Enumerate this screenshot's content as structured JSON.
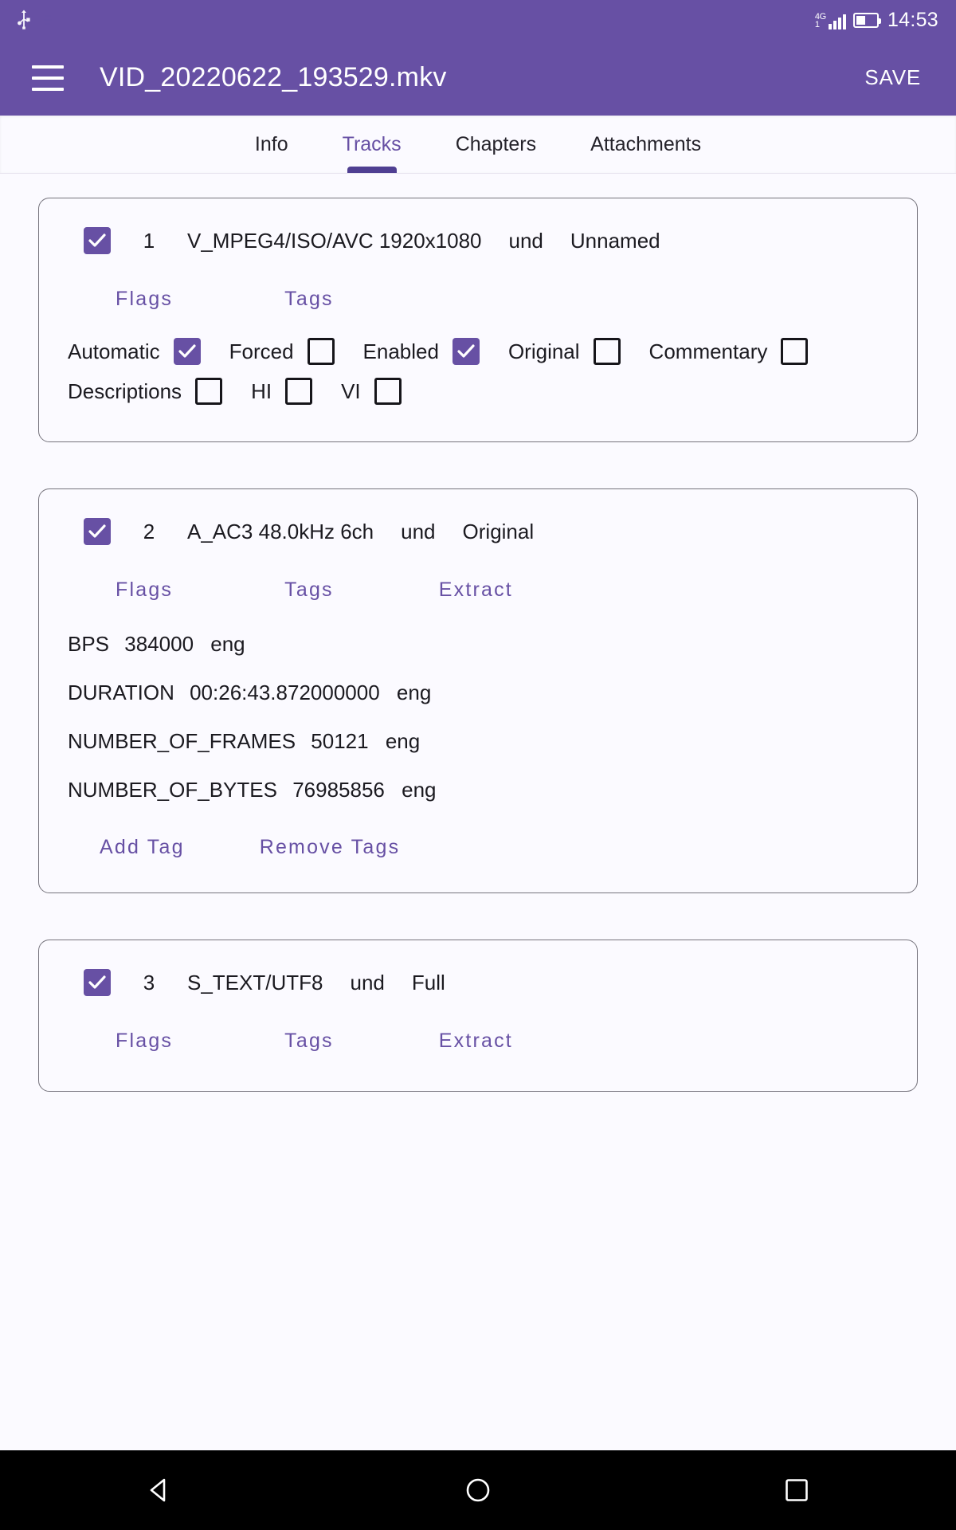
{
  "status_bar": {
    "usb_icon": "usb-icon",
    "dnd_icon": "moon-do-not-disturb-icon",
    "network_type": "4G",
    "network_sub": "1",
    "battery_icon": "battery-half-icon",
    "time": "14:53"
  },
  "app_bar": {
    "menu_icon": "hamburger-menu-icon",
    "title": "VID_20220622_193529.mkv",
    "save_label": "SAVE"
  },
  "tabs": [
    {
      "label": "Info",
      "active": false
    },
    {
      "label": "Tracks",
      "active": true
    },
    {
      "label": "Chapters",
      "active": false
    },
    {
      "label": "Attachments",
      "active": false
    }
  ],
  "colors": {
    "primary": "#6750a4",
    "primary_dark": "#4f3f92",
    "surface": "#fbfaff",
    "on_surface": "#1b1a20",
    "card_border": "#75737c",
    "nav_bar": "#000000"
  },
  "tracks": [
    {
      "checked": true,
      "number": "1",
      "codec": "V_MPEG4/ISO/AVC 1920x1080",
      "language": "und",
      "name": "Unnamed",
      "actions": [
        "Flags",
        "Tags"
      ],
      "flags": [
        {
          "label": "Automatic",
          "checked": true
        },
        {
          "label": "Forced",
          "checked": false
        },
        {
          "label": "Enabled",
          "checked": true
        },
        {
          "label": "Original",
          "checked": false
        },
        {
          "label": "Commentary",
          "checked": false
        },
        {
          "label": "Descriptions",
          "checked": false
        },
        {
          "label": "HI",
          "checked": false
        },
        {
          "label": "VI",
          "checked": false
        }
      ]
    },
    {
      "checked": true,
      "number": "2",
      "codec": "A_AC3 48.0kHz 6ch",
      "language": "und",
      "name": "Original",
      "actions": [
        "Flags",
        "Tags",
        "Extract"
      ],
      "tags": [
        {
          "key": "BPS",
          "value": "384000",
          "lang": "eng"
        },
        {
          "key": "DURATION",
          "value": "00:26:43.872000000",
          "lang": "eng"
        },
        {
          "key": "NUMBER_OF_FRAMES",
          "value": "50121",
          "lang": "eng"
        },
        {
          "key": "NUMBER_OF_BYTES",
          "value": "76985856",
          "lang": "eng"
        }
      ],
      "tag_actions": [
        "Add Tag",
        "Remove Tags"
      ]
    },
    {
      "checked": true,
      "number": "3",
      "codec": "S_TEXT/UTF8",
      "language": "und",
      "name": "Full",
      "actions": [
        "Flags",
        "Tags",
        "Extract"
      ]
    }
  ],
  "nav_bar": {
    "back_icon": "triangle-back-icon",
    "home_icon": "circle-home-icon",
    "recents_icon": "square-recents-icon"
  }
}
